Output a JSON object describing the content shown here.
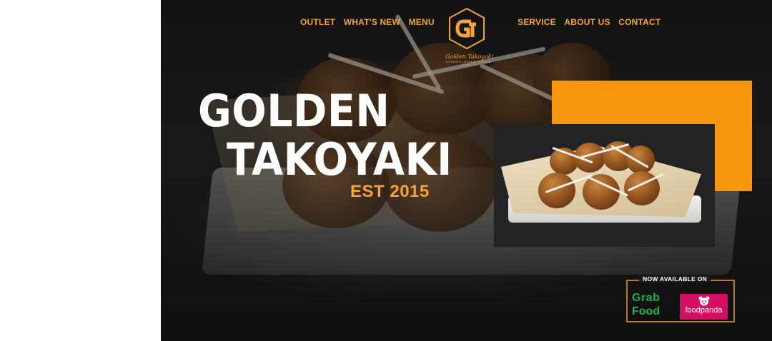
{
  "nav": {
    "left": [
      "OUTLET",
      "WHAT'S NEW",
      "MENU"
    ],
    "right": [
      "SERVICE",
      "ABOUT US",
      "CONTACT"
    ]
  },
  "logo": {
    "name": "Golden Takoyaki",
    "tagline": "AUTHENTIC JAPANESE TAKOYAKI",
    "est": "EST 2015"
  },
  "hero": {
    "title_line1": "GOLDEN",
    "title_line2": "TAKOYAKI",
    "est": "EST 2015"
  },
  "availability": {
    "label": "NOW AVAILABLE ON",
    "grab_line1": "Grab",
    "grab_line2": "Food",
    "foodpanda": "foodpanda"
  },
  "colors": {
    "accent": "#f2a43a",
    "orange_block": "#f8960e",
    "grabfood": "#1fb04b",
    "foodpanda": "#d70f64"
  },
  "icons": [
    "golden-takoyaki-logo",
    "foodpanda-panda-icon"
  ]
}
